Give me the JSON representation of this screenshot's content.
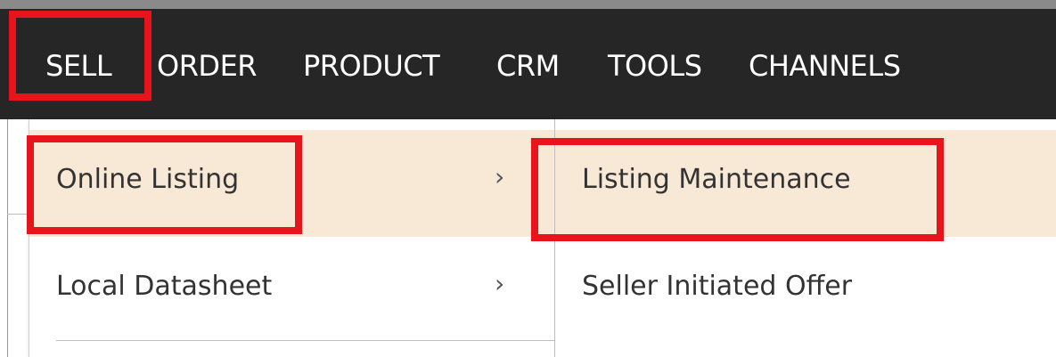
{
  "nav": {
    "items": [
      {
        "label": "SELL"
      },
      {
        "label": "ORDER"
      },
      {
        "label": "PRODUCT"
      },
      {
        "label": "CRM"
      },
      {
        "label": "TOOLS"
      },
      {
        "label": "CHANNELS"
      }
    ]
  },
  "menu_level1": {
    "items": [
      {
        "label": "Online Listing",
        "chevron": "›",
        "highlighted": true
      },
      {
        "label": "Local Datasheet",
        "chevron": "›",
        "highlighted": false
      }
    ]
  },
  "menu_level2": {
    "items": [
      {
        "label": "Listing Maintenance",
        "highlighted": true
      },
      {
        "label": "Seller Initiated Offer",
        "highlighted": false
      }
    ]
  },
  "colors": {
    "navbar_bg": "#262626",
    "nav_text": "#ffffff",
    "hover_bg": "#f8e8d6",
    "annotation_red": "#e8131b"
  },
  "icons": {
    "submenu_arrow": "chevron-right-icon"
  }
}
